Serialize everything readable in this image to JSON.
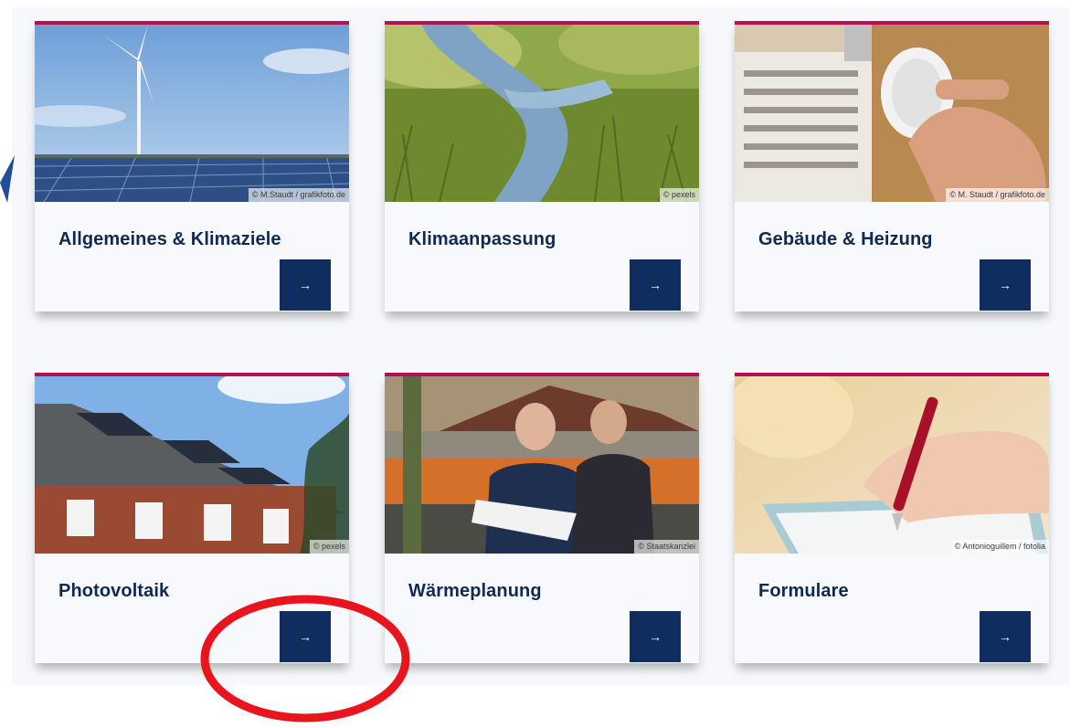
{
  "cards": [
    {
      "title": "Allgemeines & Klimaziele",
      "credit": "© M.Staudt / grafikfoto.de",
      "arrow": "→",
      "image_icon": "wind-solar-photo"
    },
    {
      "title": "Klimaanpassung",
      "credit": "© pexels",
      "arrow": "→",
      "image_icon": "stream-meadow-photo"
    },
    {
      "title": "Gebäude & Heizung",
      "credit": "© M. Staudt / grafikfoto.de",
      "arrow": "→",
      "image_icon": "radiator-thermostat-photo"
    },
    {
      "title": "Photovoltaik",
      "credit": "© pexels",
      "arrow": "→",
      "image_icon": "house-solar-roof-photo"
    },
    {
      "title": "Wärmeplanung",
      "credit": "© Staatskanzlei",
      "arrow": "→",
      "image_icon": "two-men-plans-photo"
    },
    {
      "title": "Formulare",
      "credit": "© Antonioguillem / fotolia",
      "arrow": "→",
      "image_icon": "pen-writing-photo"
    }
  ],
  "colors": {
    "accent_border": "#b4124f",
    "title_text": "#0f2a52",
    "button_bg": "#0f2e5f",
    "annotation": "#e8141e"
  }
}
